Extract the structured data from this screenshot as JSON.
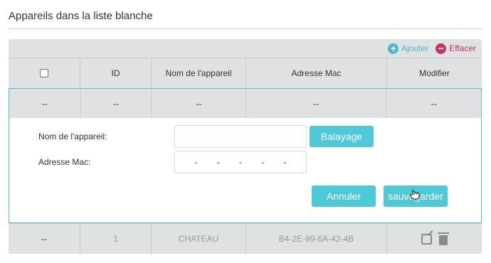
{
  "section": {
    "title": "Appareils dans la liste blanche"
  },
  "toolbar": {
    "add_label": "Ajouter",
    "add_icon": "plus-circle-icon",
    "delete_label": "Effacer",
    "delete_icon": "minus-circle-icon"
  },
  "table": {
    "headers": {
      "id": "ID",
      "device_name": "Nom de l'appareil",
      "mac": "Adresse Mac",
      "modify": "Modifier"
    },
    "placeholder_row": {
      "select": "--",
      "id": "--",
      "device_name": "--",
      "mac": "--",
      "modify": "--"
    },
    "rows": [
      {
        "select": "--",
        "id": "1",
        "device_name": "CHATEAU",
        "mac": "B4-2E-99-6A-42-4B"
      }
    ]
  },
  "form": {
    "device_name_label": "Nom de l'appareil:",
    "device_name_value": "",
    "mac_label": "Adresse Mac:",
    "mac_separators": [
      "-",
      "-",
      "-",
      "-",
      "-"
    ],
    "scan_button": "Balayage",
    "cancel_button": "Annuler",
    "save_button": "sauvegarder"
  },
  "colors": {
    "accent": "#4ec9d8",
    "delete": "#c0356d",
    "table_bg": "#dfe1e2"
  }
}
